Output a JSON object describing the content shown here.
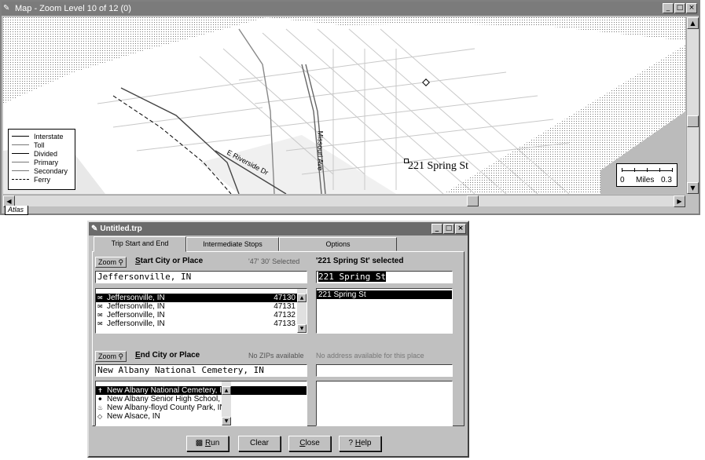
{
  "map_window": {
    "title": "Map - Zoom Level 10 of 12 (0)",
    "buttons": {
      "minimize": "_",
      "maximize": "□",
      "close": "×"
    },
    "legend": {
      "items": [
        {
          "label": "Interstate"
        },
        {
          "label": "Toll"
        },
        {
          "label": "Divided"
        },
        {
          "label": "Primary"
        },
        {
          "label": "Secondary"
        },
        {
          "label": "Ferry"
        }
      ]
    },
    "street_labels": {
      "riverside": "E Riverside Dr",
      "missouri": "Missouri Ave"
    },
    "address_label": "221 Spring St",
    "scale": {
      "zero": "0",
      "unit": "Miles",
      "max": "0.3"
    },
    "tab_label": "Atlas"
  },
  "dialog": {
    "title": "Untitled.trp",
    "tabs": [
      "Trip Start and End",
      "Intermediate Stops",
      "Options"
    ],
    "start": {
      "zoom_label": "Zoom",
      "label_first": "S",
      "label_rest": "tart City or Place",
      "selected_count": "'47' 30' Selected",
      "city_value": "Jeffersonville, IN",
      "list": [
        {
          "name": "Jeffersonville, IN",
          "zip": "47130",
          "selected": true
        },
        {
          "name": "Jeffersonville, IN",
          "zip": "47131",
          "selected": false
        },
        {
          "name": "Jeffersonville, IN",
          "zip": "47132",
          "selected": false
        },
        {
          "name": "Jeffersonville, IN",
          "zip": "47133",
          "selected": false
        }
      ],
      "address_status": "'221 Spring St' selected",
      "address_value": "221 Spring St",
      "address_list": [
        "221 Spring St"
      ]
    },
    "end": {
      "zoom_label": "Zoom",
      "label_first": "E",
      "label_rest": "nd City or Place",
      "zip_status": "No ZIPs available",
      "city_value": "New Albany National Cemetery, IN",
      "list": [
        {
          "name": "New Albany National Cemetery, IN",
          "selected": true
        },
        {
          "name": "New Albany Senior High School, IN",
          "selected": false
        },
        {
          "name": "New Albany-floyd County Park, IN",
          "selected": false
        },
        {
          "name": "New Alsace, IN",
          "selected": false
        }
      ],
      "address_status": "No address available for this place",
      "address_value": ""
    },
    "buttons": {
      "run_first": "R",
      "run_rest": "un",
      "clear": "Clear",
      "close_first": "C",
      "close_rest": "lose",
      "help_first": "H",
      "help_rest": "elp",
      "help_prefix": "?"
    }
  }
}
